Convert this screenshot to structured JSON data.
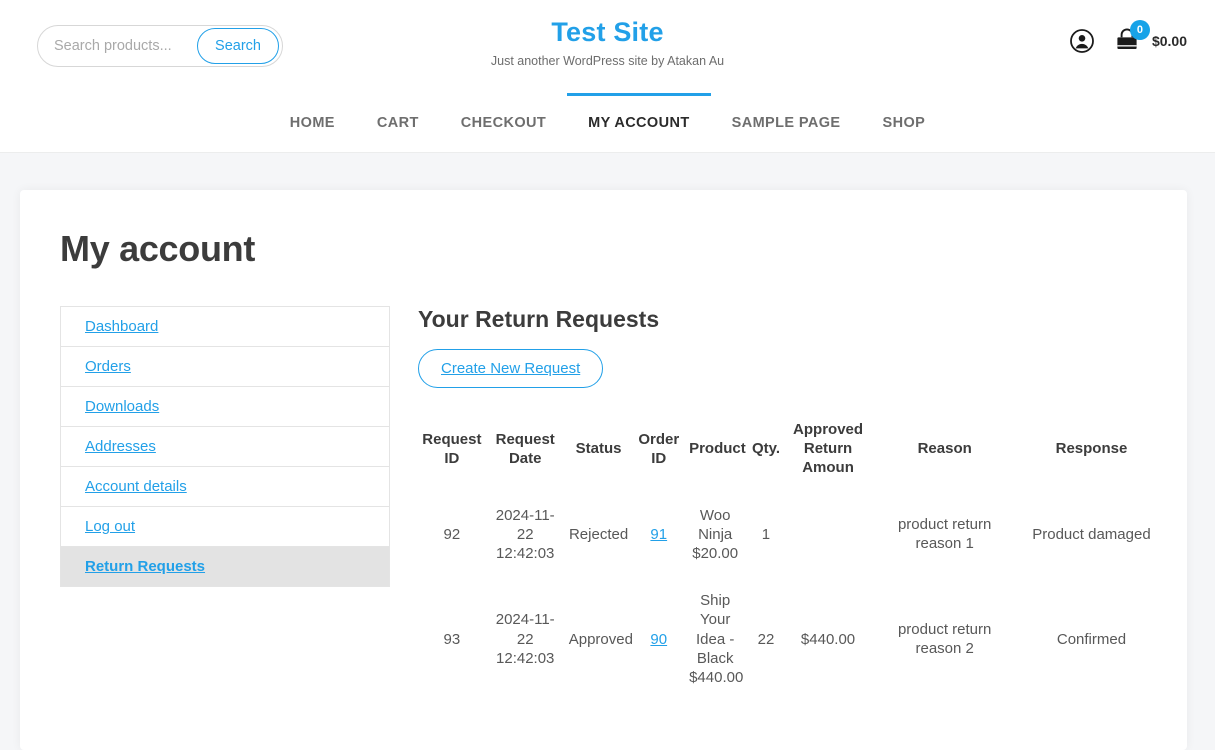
{
  "header": {
    "search": {
      "placeholder": "Search products...",
      "value": "",
      "button_label": "Search"
    },
    "brand": {
      "title": "Test Site",
      "tagline": "Just another WordPress site by Atakan Au"
    },
    "account_icon": "account-icon",
    "cart": {
      "icon": "shopping-bag-icon",
      "count": "0",
      "total": "$0.00"
    },
    "accent_color": "#22a0e8"
  },
  "nav": {
    "items": [
      {
        "label": "HOME",
        "active": false
      },
      {
        "label": "CART",
        "active": false
      },
      {
        "label": "CHECKOUT",
        "active": false
      },
      {
        "label": "MY ACCOUNT",
        "active": true
      },
      {
        "label": "SAMPLE PAGE",
        "active": false
      },
      {
        "label": "SHOP",
        "active": false
      }
    ]
  },
  "page": {
    "title": "My account"
  },
  "account_nav": {
    "items": [
      {
        "label": "Dashboard",
        "active": false
      },
      {
        "label": "Orders",
        "active": false
      },
      {
        "label": "Downloads",
        "active": false
      },
      {
        "label": "Addresses",
        "active": false
      },
      {
        "label": "Account details",
        "active": false
      },
      {
        "label": "Log out",
        "active": false
      },
      {
        "label": "Return Requests",
        "active": true
      }
    ]
  },
  "main": {
    "title": "Your Return Requests",
    "create_button": "Create New Request",
    "table": {
      "columns": [
        "Request ID",
        "Request Date",
        "Status",
        "Order ID",
        "Product",
        "Qty.",
        "Approved Return Amoun",
        "Reason",
        "Response"
      ],
      "rows": [
        {
          "request_id": "92",
          "request_date": "2024-11-22 12:42:03",
          "status": "Rejected",
          "order_id": "91",
          "product": "Woo Ninja $20.00",
          "qty": "1",
          "approved_return_amount": "",
          "reason": "product return reason 1",
          "response": "Product damaged"
        },
        {
          "request_id": "93",
          "request_date": "2024-11-22 12:42:03",
          "status": "Approved",
          "order_id": "90",
          "product": "Ship Your Idea - Black $440.00",
          "qty": "22",
          "approved_return_amount": "$440.00",
          "reason": "product return reason 2",
          "response": "Confirmed"
        }
      ]
    }
  }
}
